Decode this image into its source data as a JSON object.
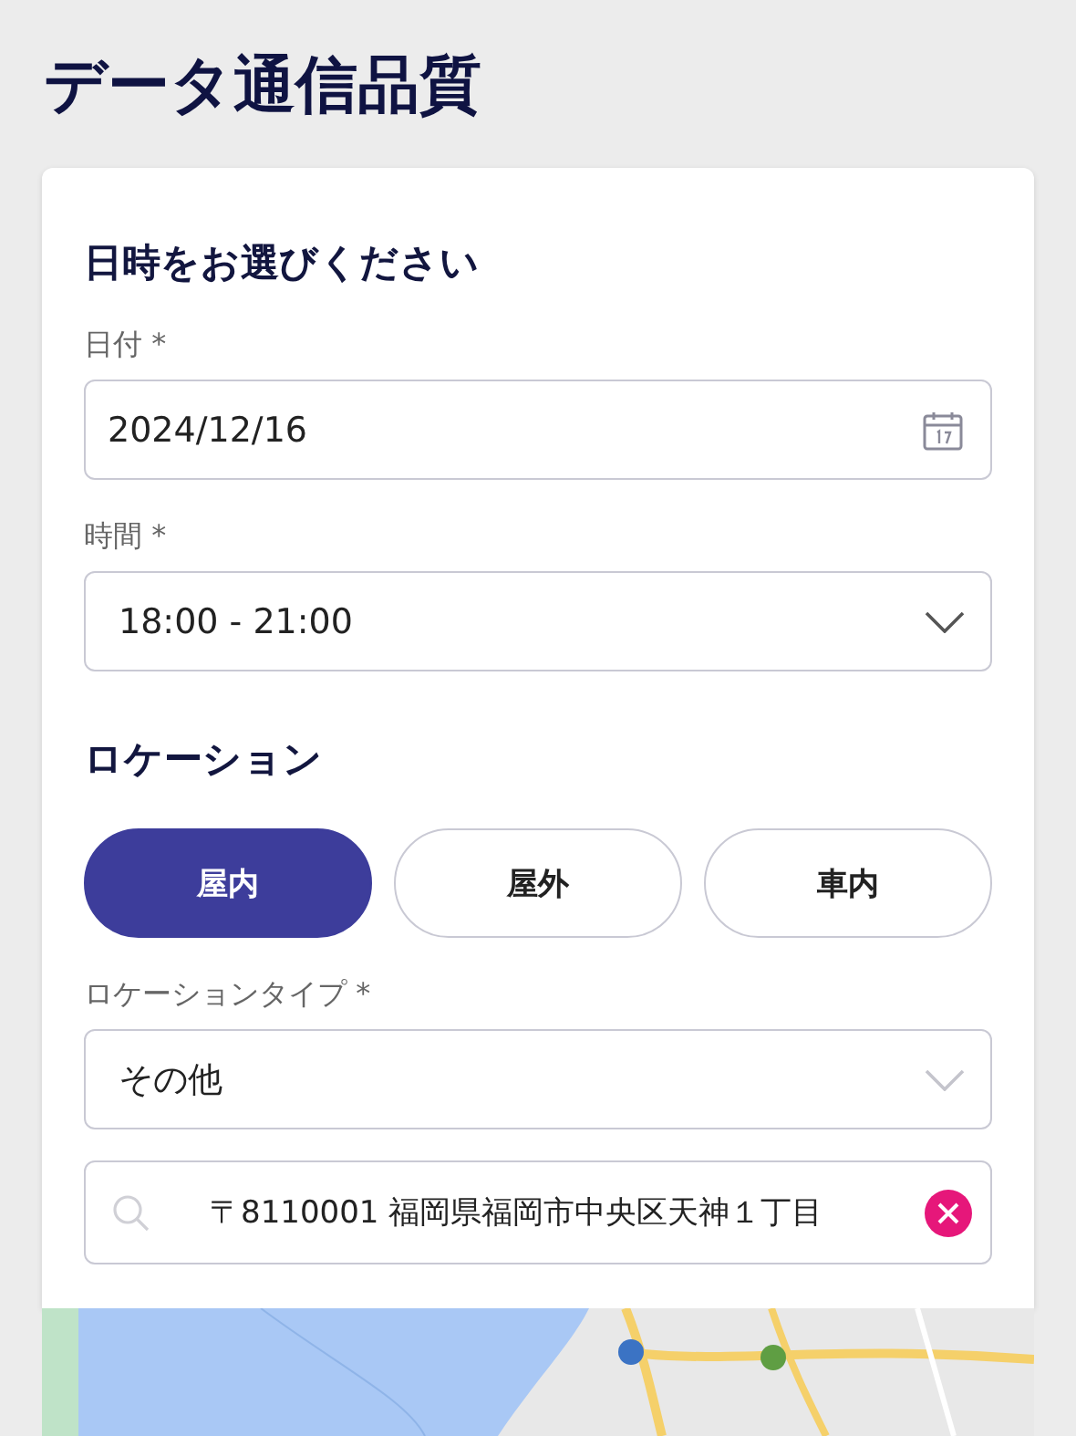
{
  "page_title": "データ通信品質",
  "datetime_section": {
    "heading": "日時をお選びください",
    "date": {
      "label": "日付 *",
      "value": "2024/12/16"
    },
    "time": {
      "label": "時間 *",
      "value": "18:00 - 21:00"
    }
  },
  "location_section": {
    "heading": "ロケーション",
    "options": [
      {
        "label": "屋内",
        "selected": true
      },
      {
        "label": "屋外",
        "selected": false
      },
      {
        "label": "車内",
        "selected": false
      }
    ],
    "location_type": {
      "label": "ロケーションタイプ *",
      "value": "その他"
    },
    "address": {
      "value": "〒8110001 福岡県福岡市中央区天神１丁目"
    }
  }
}
